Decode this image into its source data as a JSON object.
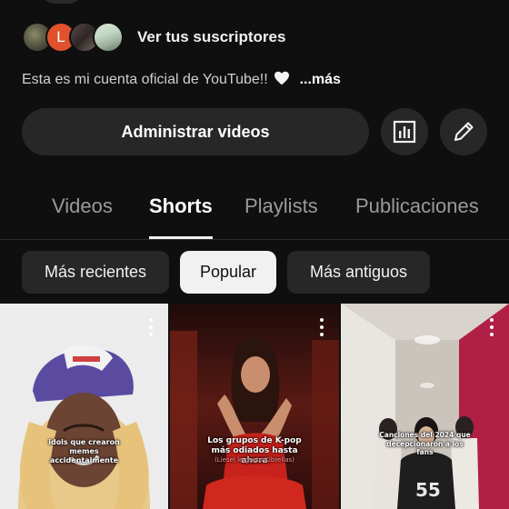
{
  "subscribers": {
    "label": "Ver tus suscriptores",
    "avatar_initial": "L"
  },
  "description": {
    "text": "Esta es mi cuenta oficial de YouTube!!",
    "emoji": "white-heart",
    "more_label": "...más"
  },
  "actions": {
    "manage_videos_label": "Administrar videos",
    "stats_icon": "bar-chart-icon",
    "edit_icon": "pencil-icon"
  },
  "tabs": [
    {
      "label": "Videos",
      "active": false
    },
    {
      "label": "Shorts",
      "active": true
    },
    {
      "label": "Playlists",
      "active": false
    },
    {
      "label": "Publicaciones",
      "active": false
    }
  ],
  "filters": [
    {
      "label": "Más recientes",
      "selected": false
    },
    {
      "label": "Popular",
      "selected": true
    },
    {
      "label": "Más antiguos",
      "selected": false
    }
  ],
  "shorts": [
    {
      "caption": "idols que crearon memes accidentalmente",
      "subcaption": ""
    },
    {
      "caption": "Los grupos de K-pop más odiados hasta ahora",
      "subcaption": "(Liesel le gusto Kibrellas)"
    },
    {
      "caption": "Canciones del 2024 que decepcionaron a los fans",
      "subcaption": ""
    }
  ],
  "colors": {
    "background": "#0f0f0f",
    "button_bg": "#272727",
    "chip_selected_bg": "#f1f1f1",
    "text_primary": "#f1f1f1",
    "text_secondary": "#9a9a9a",
    "avatar_orange": "#e0512c"
  }
}
